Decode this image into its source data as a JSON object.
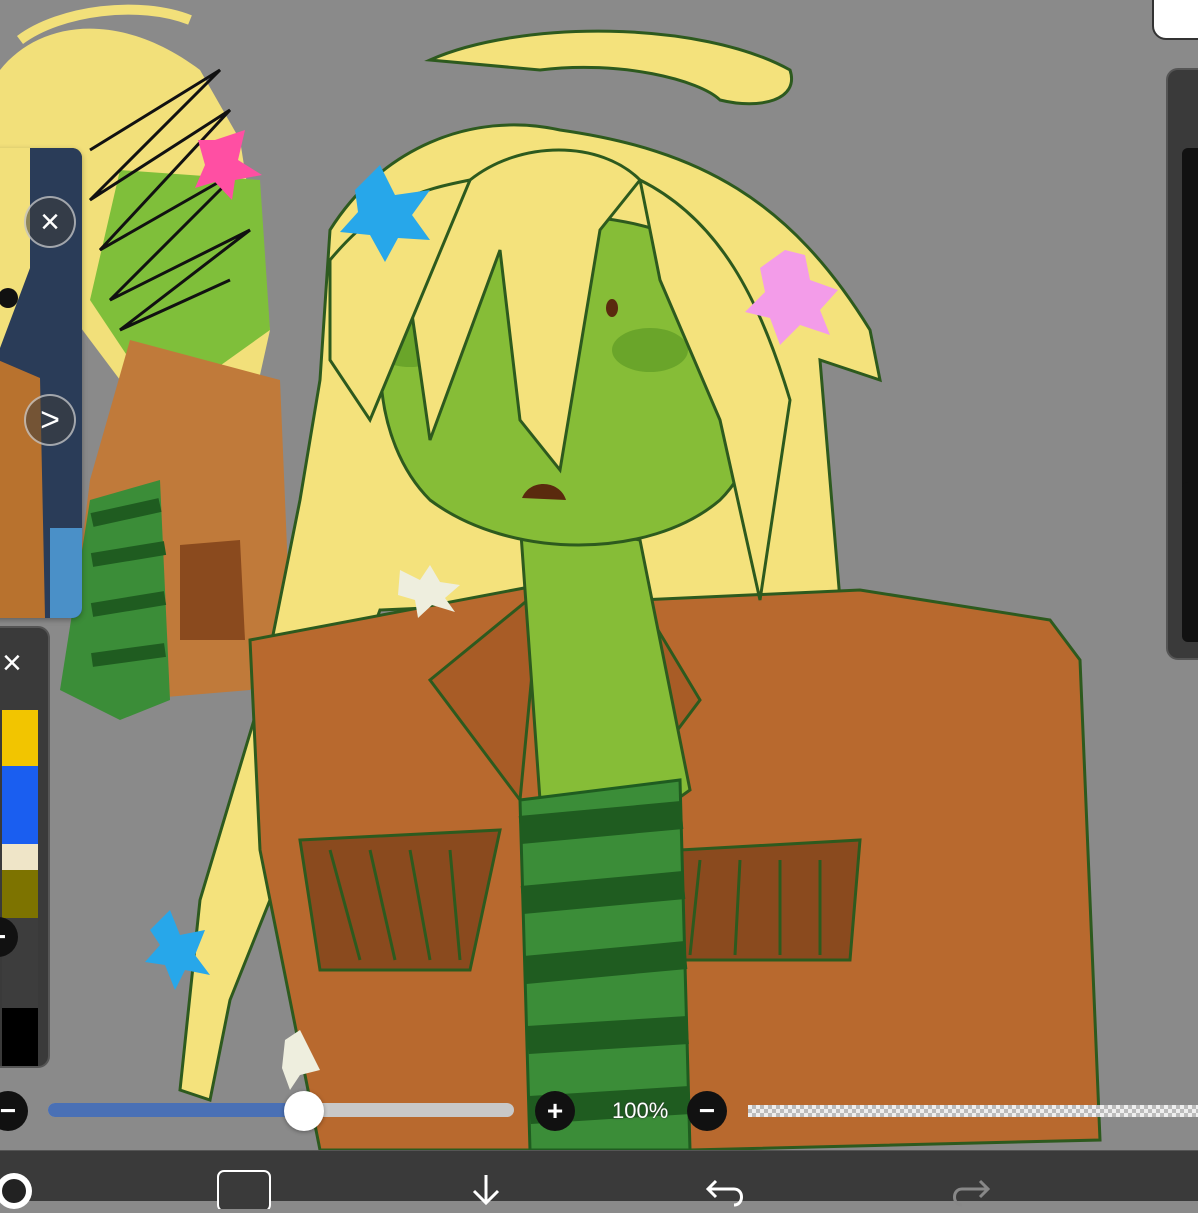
{
  "app": {
    "accent_color": "#4a70b5",
    "canvas_background": "#8a8a8a"
  },
  "reference_window": {
    "close_icon": "close-icon",
    "next_icon": "chevron-right-icon",
    "close_glyph": "×",
    "next_glyph": ">"
  },
  "color_history": {
    "close_glyph": "×",
    "minus_glyph": "−",
    "swatches": [
      "#f2c500",
      "#1a5ef0",
      "#efe5c8",
      "#7d7300",
      "#3d3d3d",
      "#000000"
    ]
  },
  "brush_size": {
    "minus_glyph": "−",
    "plus_glyph": "+",
    "value_fraction": 0.55
  },
  "opacity": {
    "label": "100%",
    "minus_glyph": "−"
  }
}
